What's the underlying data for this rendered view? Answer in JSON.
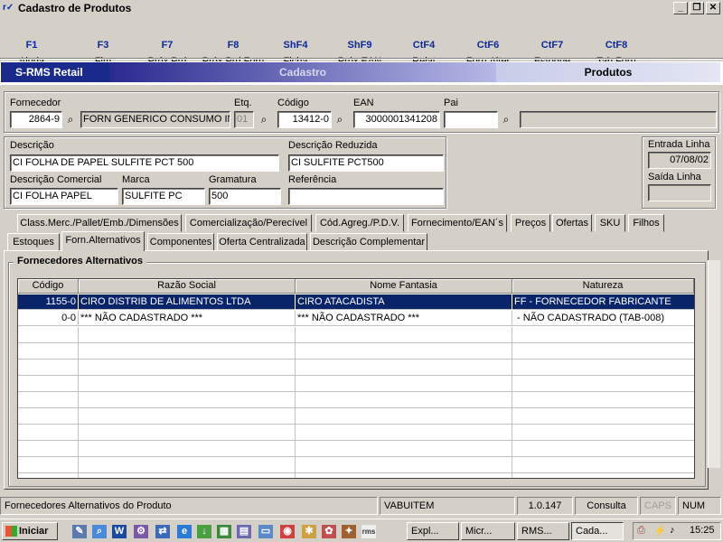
{
  "window": {
    "title": "Cadastro de Produtos",
    "icon": "rms-app-icon"
  },
  "toolbar": [
    {
      "key": "F1",
      "label": "Ajuda"
    },
    {
      "key": "F3",
      "label": "Fim"
    },
    {
      "key": "F7",
      "label": "Próx.Prd"
    },
    {
      "key": "F8",
      "label": "Próx.Prd.Forn"
    },
    {
      "key": "ShF4",
      "label": "Ficha"
    },
    {
      "key": "ShF9",
      "label": "Próx.EAN"
    },
    {
      "key": "CtF4",
      "label": "Relat"
    },
    {
      "key": "CtF6",
      "label": "Forn.Alter"
    },
    {
      "key": "CtF7",
      "label": "Estoque"
    },
    {
      "key": "CtF8",
      "label": "Tab.Forn"
    }
  ],
  "banner": {
    "app": "S-RMS Retail",
    "section": "Cadastro",
    "module": "Produtos"
  },
  "header": {
    "fornecedor_label": "Fornecedor",
    "fornecedor_code": "2864-9",
    "fornecedor_name": "FORN GENERICO CONSUMO INTERNO",
    "etq_label": "Etq.",
    "etq_value": "01",
    "codigo_label": "Código",
    "codigo_value": "13412-0",
    "ean_label": "EAN",
    "ean_value": "3000001341208",
    "pai_label": "Pai",
    "pai_value": "",
    "pai_desc": ""
  },
  "product": {
    "descricao_label": "Descrição",
    "descricao_value": "CI FOLHA DE PAPEL SULFITE PCT 500",
    "reduzida_label": "Descrição Reduzida",
    "reduzida_value": "CI SULFITE PCT500",
    "comercial_label": "Descrição Comercial",
    "comercial_value": "CI FOLHA PAPEL",
    "marca_label": "Marca",
    "marca_value": "SULFITE PC",
    "gramatura_label": "Gramatura",
    "gramatura_value": "500",
    "referencia_label": "Referência",
    "referencia_value": ""
  },
  "linha": {
    "entrada_label": "Entrada Linha",
    "entrada_value": "07/08/02",
    "saida_label": "Saída Linha",
    "saida_value": ""
  },
  "tabs_row1": [
    "Class.Merc./Pallet/Emb./Dimensões",
    "Comercialização/Perecível",
    "Cód.Agreg./P.D.V.",
    "Fornecimento/EAN´s",
    "Preços",
    "Ofertas",
    "SKU",
    "Filhos"
  ],
  "tabs_row2": [
    "Estoques",
    "Forn.Alternativos",
    "Componentes",
    "Oferta Centralizada",
    "Descrição Complementar"
  ],
  "active_tab": "Forn.Alternativos",
  "panel": {
    "title": "Fornecedores Alternativos",
    "columns": [
      "Código",
      "Razão Social",
      "Nome Fantasia",
      "Natureza"
    ],
    "rows": [
      [
        "1155-0",
        "CIRO DISTRIB DE ALIMENTOS LTDA",
        "CIRO ATACADISTA",
        "FF - FORNECEDOR FABRICANTE"
      ],
      [
        "0-0",
        "*** NÃO CADASTRADO ***",
        "*** NÃO CADASTRADO ***",
        " - NÃO CADASTRADO (TAB-008)"
      ]
    ],
    "selected_row": 0
  },
  "statusbar": {
    "message": "Fornecedores Alternativos do Produto",
    "user": "VABUITEM",
    "version": "1.0.147",
    "mode": "Consulta",
    "caps": "CAPS",
    "num": "NUM"
  },
  "taskbar": {
    "start_label": "Iniciar",
    "tasks": [
      "Expl...",
      "Micr...",
      "RMS...",
      "Cada..."
    ],
    "clock": "15:25"
  },
  "colors": {
    "selection": "#0a246a",
    "banner_dark": "#1a2a8c",
    "accent_key": "#0a2a9e",
    "face": "#d4d0c8"
  }
}
